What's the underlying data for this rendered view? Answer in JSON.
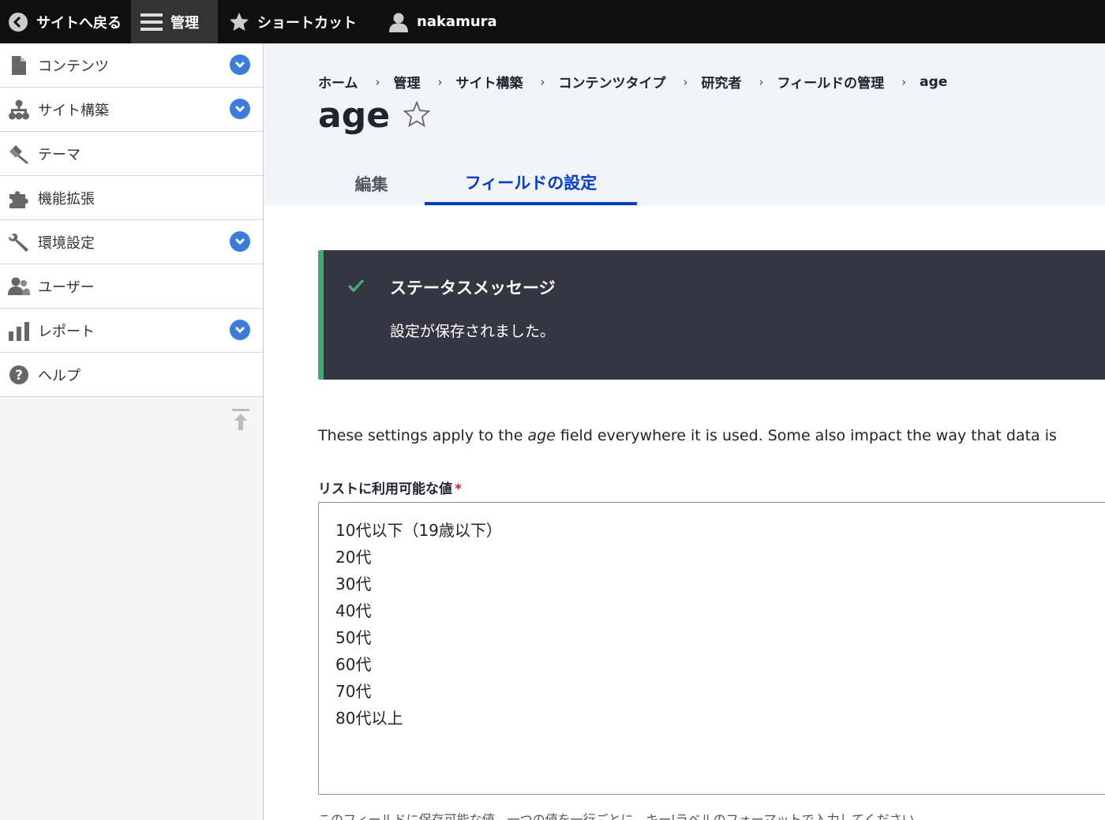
{
  "toolbar": {
    "back_label": "サイトへ戻る",
    "manage_label": "管理",
    "shortcut_label": "ショートカット",
    "user_label": "nakamura"
  },
  "sidebar": {
    "items": [
      {
        "label": "コンテンツ",
        "icon": "file-icon",
        "has_toggle": true
      },
      {
        "label": "サイト構築",
        "icon": "sitemap-icon",
        "has_toggle": true
      },
      {
        "label": "テーマ",
        "icon": "brush-icon",
        "has_toggle": false
      },
      {
        "label": "機能拡張",
        "icon": "puzzle-icon",
        "has_toggle": false
      },
      {
        "label": "環境設定",
        "icon": "wrench-icon",
        "has_toggle": true
      },
      {
        "label": "ユーザー",
        "icon": "users-icon",
        "has_toggle": false
      },
      {
        "label": "レポート",
        "icon": "bar-chart-icon",
        "has_toggle": true
      },
      {
        "label": "ヘルプ",
        "icon": "help-icon",
        "has_toggle": false
      }
    ]
  },
  "breadcrumb": [
    "ホーム",
    "管理",
    "サイト構築",
    "コンテンツタイプ",
    "研究者",
    "フィールドの管理",
    "age"
  ],
  "page": {
    "title": "age"
  },
  "tabs": [
    {
      "label": "編集",
      "active": false
    },
    {
      "label": "フィールドの設定",
      "active": true
    }
  ],
  "status": {
    "title": "ステータスメッセージ",
    "message": "設定が保存されました。"
  },
  "description": {
    "before": "These settings apply to the ",
    "field": "age",
    "after": " field everywhere it is used. Some also impact the way that data is"
  },
  "allowed_values": {
    "label": "リストに利用可能な値",
    "required_mark": "*",
    "lines": [
      "10代以下（19歳以下）",
      "20代",
      "30代",
      "40代",
      "50代",
      "60代",
      "70代",
      "80代以上"
    ],
    "help": "このフィールドに保存可能な値。一つの値を一行ごとに、キー|ラベルのフォーマットで入力してください。"
  },
  "colors": {
    "accent": "#003ecc",
    "toggle": "#3b7dd8",
    "status_bg": "#353641",
    "status_border": "#42a877",
    "toolbar_bg": "#0f0f0f"
  }
}
